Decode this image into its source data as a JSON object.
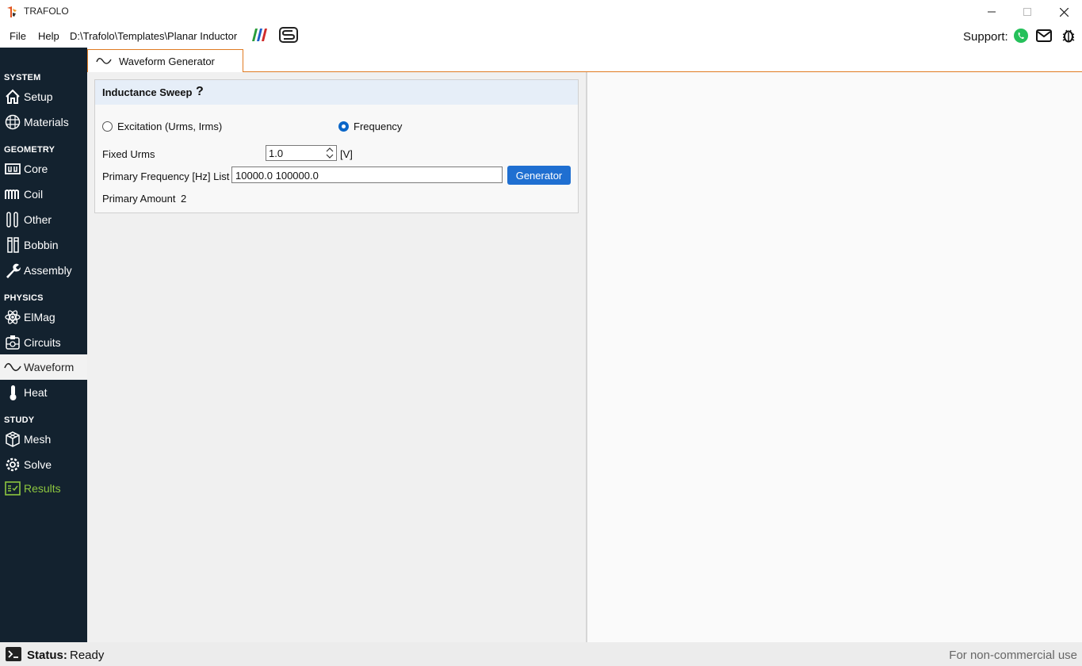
{
  "window": {
    "title": "TRAFOLO",
    "controls": [
      "minimize",
      "maximize",
      "close"
    ]
  },
  "menubar": {
    "file": "File",
    "help": "Help",
    "path": "D:\\Trafolo\\Templates\\Planar Inductor",
    "support_label": "Support:",
    "support_icons": [
      "whatsapp-icon",
      "mail-icon",
      "bug-icon"
    ]
  },
  "tabs": [
    {
      "label": "Waveform Generator",
      "icon": "sine-wave-icon",
      "active": true
    }
  ],
  "sidebar": {
    "sections": [
      {
        "label": "SYSTEM",
        "items": [
          {
            "label": "Setup",
            "icon": "home-icon"
          },
          {
            "label": "Materials",
            "icon": "grid-globe-icon"
          }
        ]
      },
      {
        "label": "GEOMETRY",
        "items": [
          {
            "label": "Core",
            "icon": "core-icon"
          },
          {
            "label": "Coil",
            "icon": "coil-icon"
          },
          {
            "label": "Other",
            "icon": "other-icon"
          },
          {
            "label": "Bobbin",
            "icon": "bobbin-icon"
          },
          {
            "label": "Assembly",
            "icon": "wrench-icon"
          }
        ]
      },
      {
        "label": "PHYSICS",
        "items": [
          {
            "label": "ElMag",
            "icon": "atom-icon"
          },
          {
            "label": "Circuits",
            "icon": "circuit-icon"
          },
          {
            "label": "Waveform",
            "icon": "sine-wave-icon",
            "active": true
          },
          {
            "label": "Heat",
            "icon": "thermometer-icon"
          }
        ]
      },
      {
        "label": "STUDY",
        "items": [
          {
            "label": "Mesh",
            "icon": "mesh-cube-icon"
          },
          {
            "label": "Solve",
            "icon": "gear-icon"
          },
          {
            "label": "Results",
            "icon": "results-checklist-icon",
            "color": "#8dc63f"
          }
        ]
      }
    ]
  },
  "panel": {
    "title": "Inductance Sweep",
    "help": "?",
    "mode_options": [
      {
        "label": "Excitation (Urms, Irms)",
        "selected": false
      },
      {
        "label": "Frequency",
        "selected": true
      }
    ],
    "fixed_urms_label": "Fixed Urms",
    "fixed_urms_value": "1.0",
    "fixed_urms_unit": "[V]",
    "freq_list_label": "Primary Frequency [Hz] List",
    "freq_list_value": "10000.0 100000.0",
    "generator_button": "Generator",
    "primary_amount_label": "Primary Amount",
    "primary_amount_value": "2"
  },
  "statusbar": {
    "key": "Status:",
    "value": "Ready",
    "right_text": "For non-commercial use"
  },
  "colors": {
    "sidebar_bg": "#13222f",
    "accent_orange": "#e07b22",
    "button_blue": "#1f6fd1",
    "results_green": "#8dc63f"
  }
}
